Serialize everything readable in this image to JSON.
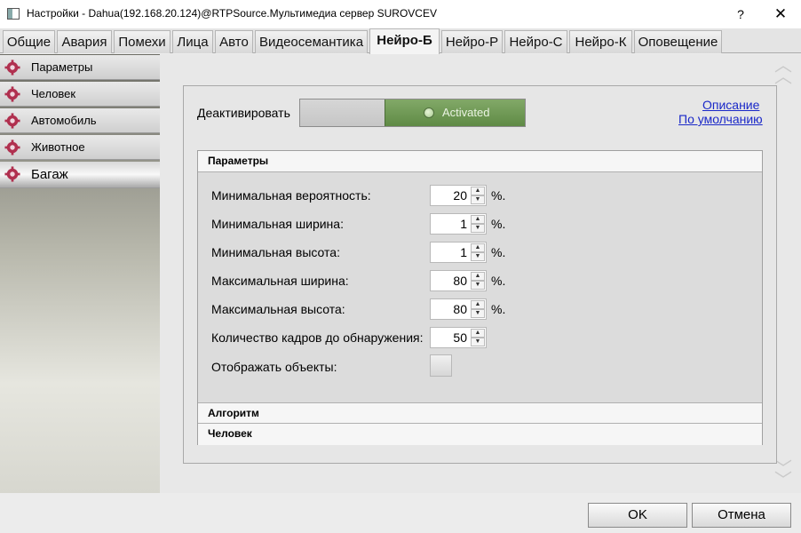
{
  "window": {
    "title": "Настройки - Dahua(192.168.20.124)@RTPSource.Мультимедиа сервер SUROVCEV",
    "help": "?",
    "close": "✕"
  },
  "tabs": [
    {
      "label": "Общие"
    },
    {
      "label": "Авария"
    },
    {
      "label": "Помехи"
    },
    {
      "label": "Лица"
    },
    {
      "label": "Авто"
    },
    {
      "label": "Видеосемантика"
    },
    {
      "label": "Нейро-Б",
      "active": true
    },
    {
      "label": "Нейро-Р"
    },
    {
      "label": "Нейро-С"
    },
    {
      "label": "Нейро-К"
    },
    {
      "label": "Оповещение"
    }
  ],
  "sidebar": {
    "items": [
      {
        "label": "Параметры"
      },
      {
        "label": "Человек"
      },
      {
        "label": "Автомобиль"
      },
      {
        "label": "Животное"
      },
      {
        "label": "Багаж",
        "active": true
      }
    ]
  },
  "main": {
    "deactivate_label": "Деактивировать",
    "toggle_state": "Activated",
    "links": {
      "description": "Описание",
      "defaults": "По умолчанию"
    },
    "group_parameters": "Параметры",
    "fields": [
      {
        "label": "Минимальная вероятность:",
        "value": "20",
        "unit": "%."
      },
      {
        "label": "Минимальная ширина:",
        "value": "1",
        "unit": "%."
      },
      {
        "label": "Минимальная высота:",
        "value": "1",
        "unit": "%."
      },
      {
        "label": "Максимальная ширина:",
        "value": "80",
        "unit": "%."
      },
      {
        "label": "Максимальная высота:",
        "value": "80",
        "unit": "%."
      },
      {
        "label": "Количество кадров до обнаружения:",
        "value": "50",
        "unit": ""
      }
    ],
    "show_objects_label": "Отображать объекты:",
    "show_objects_checked": false,
    "group_algorithm": "Алгоритм",
    "group_person": "Человек"
  },
  "buttons": {
    "ok": "OK",
    "cancel": "Отмена"
  },
  "colors": {
    "accent_green": "#6e9a52",
    "gear": "#b0304f",
    "link": "#1a28c8"
  },
  "icons": {
    "sidebar": "gear-icon",
    "scroll_up": "double-chevron-up-icon",
    "scroll_down": "double-chevron-down-icon"
  }
}
